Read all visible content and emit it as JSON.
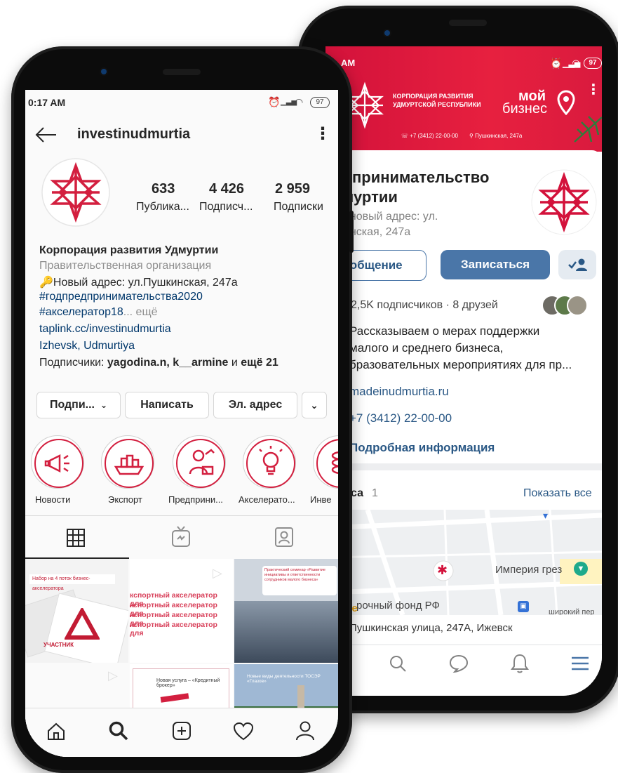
{
  "vk": {
    "status_time": "AM",
    "status_battery": "97",
    "cover": {
      "corp_line1": "КОРПОРАЦИЯ РАЗВИТИЯ",
      "corp_line2": "УДМУРТСКОЙ РЕСПУБЛИКИ",
      "brand_line1": "мой",
      "brand_line2": "бизнес",
      "phone": "+7 (3412) 22-00-00",
      "address": "Пушкинская, 247а"
    },
    "title_line1": "дпринимательство",
    "title_line2": "муртии",
    "status_line1": ": новый адрес: ул.",
    "status_line2": "инская, 247а",
    "btn_message": "ообщение",
    "btn_subscribe": "Записаться",
    "followers": "2,5K подписчиков · 8 друзей",
    "desc_line1": "Рассказываем о мерах поддержки",
    "desc_line2": "малого и среднего бизнеса,",
    "desc_line3": "бразовательных мероприятиях для пр...",
    "website": "madeinudmurtia.ru",
    "phone": "+7 (3412) 22-00-00",
    "more_info": "Подробная информация",
    "places_label": "са",
    "places_count": "1",
    "show_all": "Показать все",
    "map_place1": "Империя грез",
    "map_place2": "рочный фонд РФ",
    "map_place3": "широкий пер",
    "map_google": "gle",
    "map_address": "Пушкинская улица, 247А, Ижевск",
    "colors": {
      "accent": "#d3123b",
      "link": "#2a5885",
      "button": "#4a76a8"
    }
  },
  "ig": {
    "status_time": "0:17 AM",
    "status_battery": "97",
    "username": "investinudmurtia",
    "stats": [
      {
        "value": "633",
        "label": "Публика..."
      },
      {
        "value": "4 426",
        "label": "Подписч..."
      },
      {
        "value": "2 959",
        "label": "Подписки"
      }
    ],
    "name": "Корпорация развития Удмуртии",
    "category": "Правительственная организация",
    "bio_line": "Новый адрес: ул.Пушкинская, 247а",
    "hashtag1": "#годпредпринимательства2020",
    "hashtag2": "#акселератор18",
    "more": "... ещё",
    "link": "taplink.cc/investinudmurtia",
    "location": "Izhevsk, Udmurtiya",
    "followers_prefix": "Подписчики: ",
    "followers_names": "yagodina.n, k__armine",
    "followers_suffix": " и ",
    "followers_more": "ещё 21",
    "btn_follow": "Подпи...",
    "btn_message": "Написать",
    "btn_email": "Эл. адрес",
    "highlights": [
      "Новости",
      "Экспорт",
      "Предприни...",
      "Акселерато...",
      "Инве"
    ],
    "post1_text": "Набор на 4 поток бизнес-акселератора",
    "post1_num": "4",
    "post1_badge": "УЧАСТНИК",
    "post2_lines": [
      "кспортный акселератор для",
      "кспортный акселератор для",
      "кспортный акселератор для",
      "кспортный акселератор для"
    ],
    "post3_text": "Практический семинар «Развитие инициативы и ответственности сотрудников малого бизнеса»",
    "post5_text": "Новая услуга – «Кредитный брокер»",
    "post6_text": "Новые виды деятельности ТОСЭР «Глазов»",
    "colors": {
      "accent": "#d31f3f",
      "link": "#00376b"
    }
  }
}
